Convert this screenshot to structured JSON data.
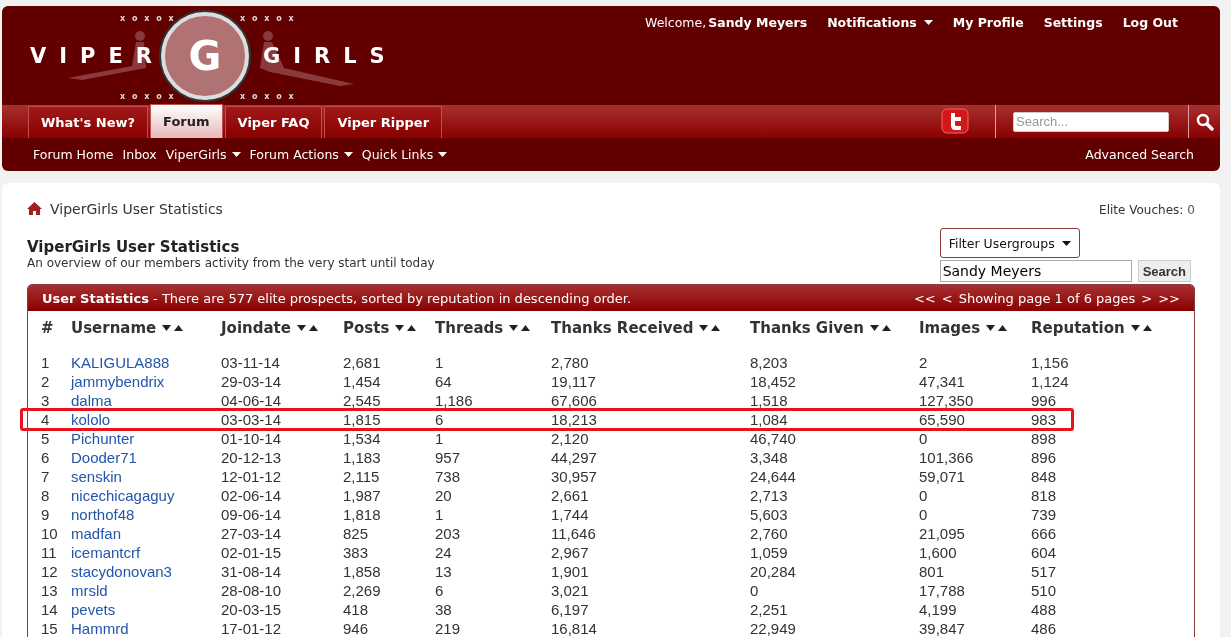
{
  "logo": {
    "left_word": "VIPER",
    "letter": "G",
    "right_word": "GIRLS",
    "ornaments": [
      "x o x o x",
      "x o x o x",
      "x o x o x",
      "x o x o x"
    ]
  },
  "user_bar": {
    "welcome": "Welcome,",
    "username": "Sandy Meyers",
    "links": [
      {
        "label": "Notifications",
        "dropdown": true
      },
      {
        "label": "My Profile",
        "dropdown": false
      },
      {
        "label": "Settings",
        "dropdown": false
      },
      {
        "label": "Log Out",
        "dropdown": false
      }
    ]
  },
  "tabs": [
    {
      "label": "What's New?",
      "selected": false
    },
    {
      "label": "Forum",
      "selected": true
    },
    {
      "label": "Viper FAQ",
      "selected": false
    },
    {
      "label": "Viper Ripper",
      "selected": false
    }
  ],
  "search": {
    "placeholder": "Search..."
  },
  "subnav": [
    {
      "label": "Forum Home",
      "dropdown": false
    },
    {
      "label": "Inbox",
      "dropdown": false
    },
    {
      "label": "ViperGirls",
      "dropdown": true
    },
    {
      "label": "Forum Actions",
      "dropdown": true
    },
    {
      "label": "Quick Links",
      "dropdown": true
    }
  ],
  "advanced_search": "Advanced Search",
  "breadcrumb": "ViperGirls User Statistics",
  "elite_vouches": {
    "label": "Elite Vouches:",
    "value": "0"
  },
  "page_title": "ViperGirls User Statistics",
  "page_subtitle": "An overview of our members activity from the very start until today",
  "filter": {
    "select": "Filter Usergroups",
    "value": "Sandy Meyers",
    "button": "Search"
  },
  "table": {
    "title": "User Statistics",
    "summary": " - There are 577 elite prospects, sorted by reputation in descending order.",
    "pagination": [
      "<<",
      "<",
      "Showing page 1 of 6 pages",
      ">",
      ">>"
    ],
    "columns": [
      {
        "label": "#",
        "sortable": false
      },
      {
        "label": "Username",
        "sortable": true
      },
      {
        "label": "Joindate",
        "sortable": true
      },
      {
        "label": "Posts",
        "sortable": true
      },
      {
        "label": "Threads",
        "sortable": true
      },
      {
        "label": "Thanks Received",
        "sortable": true
      },
      {
        "label": "Thanks Given",
        "sortable": true
      },
      {
        "label": "Images",
        "sortable": true
      },
      {
        "label": "Reputation",
        "sortable": true
      }
    ],
    "rows": [
      {
        "circled": false,
        "cells": [
          "1",
          "KALIGULA888",
          "03-11-14",
          "2,681",
          "1",
          "2,780",
          "8,203",
          "2",
          "1,156"
        ]
      },
      {
        "circled": false,
        "cells": [
          "2",
          "jammybendrix",
          "29-03-14",
          "1,454",
          "64",
          "19,117",
          "18,452",
          "47,341",
          "1,124"
        ]
      },
      {
        "circled": false,
        "cells": [
          "3",
          "dalma",
          "04-06-14",
          "2,545",
          "1,186",
          "67,606",
          "1,518",
          "127,350",
          "996"
        ]
      },
      {
        "circled": true,
        "cells": [
          "4",
          "kololo",
          "03-03-14",
          "1,815",
          "6",
          "18,213",
          "1,084",
          "65,590",
          "983"
        ]
      },
      {
        "circled": false,
        "cells": [
          "5",
          "Pichunter",
          "01-10-14",
          "1,534",
          "1",
          "2,120",
          "46,740",
          "0",
          "898"
        ]
      },
      {
        "circled": false,
        "cells": [
          "6",
          "Dooder71",
          "20-12-13",
          "1,183",
          "957",
          "44,297",
          "3,348",
          "101,366",
          "896"
        ]
      },
      {
        "circled": false,
        "cells": [
          "7",
          "senskin",
          "12-01-12",
          "2,115",
          "738",
          "30,957",
          "24,644",
          "59,071",
          "848"
        ]
      },
      {
        "circled": false,
        "cells": [
          "8",
          "nicechicagaguy",
          "02-06-14",
          "1,987",
          "20",
          "2,661",
          "2,713",
          "0",
          "818"
        ]
      },
      {
        "circled": false,
        "cells": [
          "9",
          "northof48",
          "09-06-14",
          "1,818",
          "1",
          "1,744",
          "5,603",
          "0",
          "739"
        ]
      },
      {
        "circled": false,
        "cells": [
          "10",
          "madfan",
          "27-03-14",
          "825",
          "203",
          "11,646",
          "2,760",
          "21,095",
          "666"
        ]
      },
      {
        "circled": false,
        "cells": [
          "11",
          "icemantcrf",
          "02-01-15",
          "383",
          "24",
          "2,967",
          "1,059",
          "1,600",
          "604"
        ]
      },
      {
        "circled": false,
        "cells": [
          "12",
          "stacydonovan3",
          "31-08-14",
          "1,858",
          "13",
          "1,901",
          "20,284",
          "801",
          "517"
        ]
      },
      {
        "circled": false,
        "cells": [
          "13",
          "mrsld",
          "28-08-10",
          "2,269",
          "6",
          "3,021",
          "0",
          "17,788",
          "510"
        ]
      },
      {
        "circled": false,
        "cells": [
          "14",
          "pevets",
          "20-03-15",
          "418",
          "38",
          "6,197",
          "2,251",
          "4,199",
          "488"
        ]
      },
      {
        "circled": false,
        "cells": [
          "15",
          "Hammrd",
          "17-01-12",
          "946",
          "219",
          "16,814",
          "22,949",
          "39,847",
          "486"
        ]
      }
    ]
  }
}
